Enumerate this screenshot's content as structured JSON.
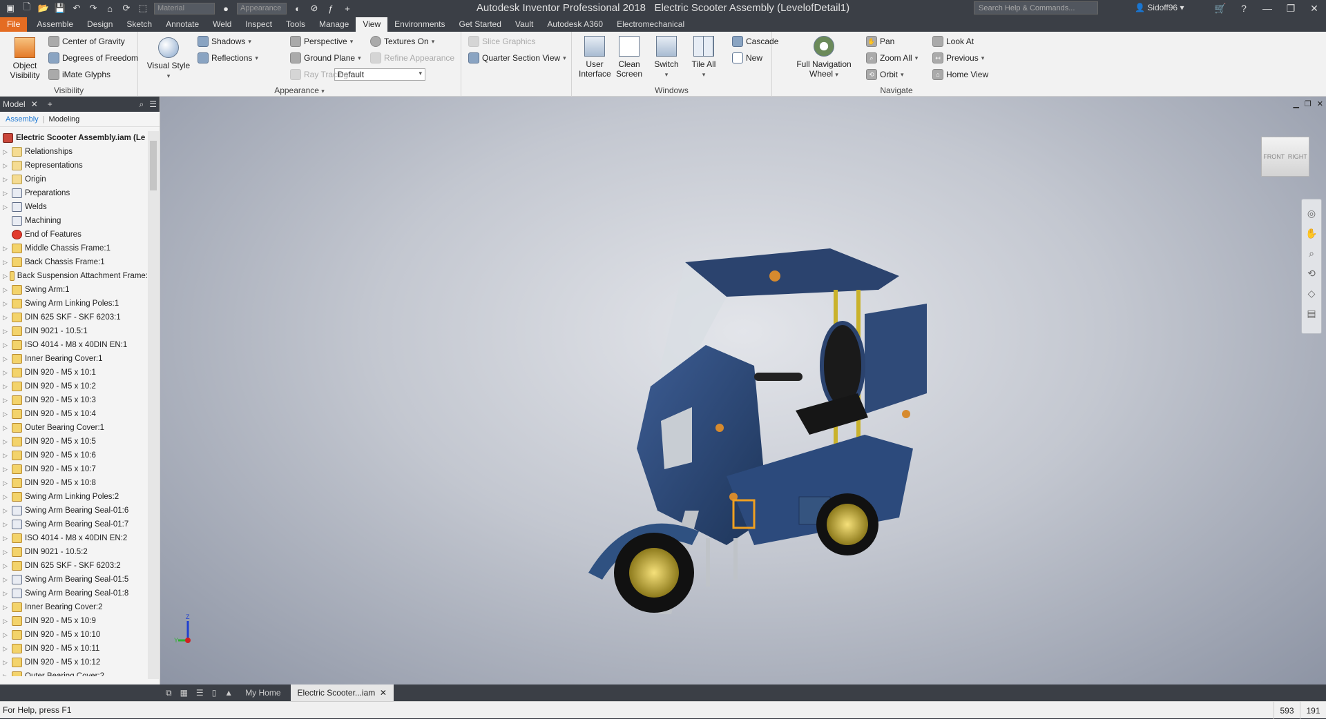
{
  "app": {
    "title": "Autodesk Inventor Professional 2018",
    "document": "Electric Scooter Assembly (LevelofDetail1)",
    "material_placeholder": "Material",
    "appearance_placeholder": "Appearance",
    "search_placeholder": "Search Help & Commands...",
    "user": "Sidoff96"
  },
  "tabs": [
    "File",
    "Assemble",
    "Design",
    "Sketch",
    "Annotate",
    "Weld",
    "Inspect",
    "Tools",
    "Manage",
    "View",
    "Environments",
    "Get Started",
    "Vault",
    "Autodesk A360",
    "Electromechanical"
  ],
  "active_tab": "View",
  "ribbon": {
    "visibility": {
      "label": "Visibility",
      "object_visibility": "Object\nVisibility",
      "center_of_gravity": "Center of Gravity",
      "degrees_of_freedom": "Degrees of Freedom",
      "imate_glyphs": "iMate Glyphs"
    },
    "appearance": {
      "label": "Appearance",
      "visual_style": "Visual Style",
      "shadows": "Shadows",
      "reflections": "Reflections",
      "default": "Default",
      "perspective": "Perspective",
      "ground_plane": "Ground Plane",
      "ray_tracing": "Ray Tracing",
      "textures_on": "Textures On",
      "refine_appearance": "Refine Appearance",
      "slice_graphics": "Slice Graphics",
      "quarter_section_view": "Quarter Section View"
    },
    "windows": {
      "label": "Windows",
      "user_interface": "User\nInterface",
      "clean_screen": "Clean\nScreen",
      "switch": "Switch",
      "tile_all": "Tile All",
      "cascade": "Cascade",
      "new": "New"
    },
    "navigate": {
      "label": "Navigate",
      "full_navigation_wheel": "Full Navigation\nWheel",
      "pan": "Pan",
      "zoom_all": "Zoom All",
      "orbit": "Orbit",
      "look_at": "Look At",
      "previous": "Previous",
      "home_view": "Home View"
    }
  },
  "browser": {
    "title": "Model",
    "tab_assembly": "Assembly",
    "tab_modeling": "Modeling",
    "root": "Electric Scooter Assembly.iam (Le",
    "items": [
      {
        "label": "Relationships",
        "icon": "folder"
      },
      {
        "label": "Representations",
        "icon": "folder"
      },
      {
        "label": "Origin",
        "icon": "folder"
      },
      {
        "label": "Preparations",
        "icon": "blue"
      },
      {
        "label": "Welds",
        "icon": "blue"
      },
      {
        "label": "Machining",
        "icon": "blue"
      },
      {
        "label": "End of Features",
        "icon": "red"
      },
      {
        "label": "Middle Chassis Frame:1",
        "icon": "part"
      },
      {
        "label": "Back Chassis Frame:1",
        "icon": "part"
      },
      {
        "label": "Back Suspension Attachment Frame:",
        "icon": "part"
      },
      {
        "label": "Swing Arm:1",
        "icon": "part"
      },
      {
        "label": "Swing Arm Linking Poles:1",
        "icon": "part"
      },
      {
        "label": "DIN 625 SKF - SKF 6203:1",
        "icon": "part"
      },
      {
        "label": "DIN 9021 - 10.5:1",
        "icon": "part"
      },
      {
        "label": "ISO 4014 - M8 x 40DIN EN:1",
        "icon": "part"
      },
      {
        "label": "Inner Bearing  Cover:1",
        "icon": "part"
      },
      {
        "label": "DIN 920 - M5 x 10:1",
        "icon": "part"
      },
      {
        "label": "DIN 920 - M5 x 10:2",
        "icon": "part"
      },
      {
        "label": "DIN 920 - M5 x 10:3",
        "icon": "part"
      },
      {
        "label": "DIN 920 - M5 x 10:4",
        "icon": "part"
      },
      {
        "label": "Outer Bearing Cover:1",
        "icon": "part"
      },
      {
        "label": "DIN 920 - M5 x 10:5",
        "icon": "part"
      },
      {
        "label": "DIN 920 - M5 x 10:6",
        "icon": "part"
      },
      {
        "label": "DIN 920 - M5 x 10:7",
        "icon": "part"
      },
      {
        "label": "DIN 920 - M5 x 10:8",
        "icon": "part"
      },
      {
        "label": "Swing Arm Linking Poles:2",
        "icon": "part"
      },
      {
        "label": "Swing Arm Bearing Seal-01:6",
        "icon": "blue"
      },
      {
        "label": "Swing Arm Bearing Seal-01:7",
        "icon": "blue"
      },
      {
        "label": "ISO 4014 - M8 x 40DIN EN:2",
        "icon": "part"
      },
      {
        "label": "DIN 9021 - 10.5:2",
        "icon": "part"
      },
      {
        "label": "DIN 625 SKF - SKF 6203:2",
        "icon": "part"
      },
      {
        "label": "Swing Arm Bearing Seal-01:5",
        "icon": "blue"
      },
      {
        "label": "Swing Arm Bearing Seal-01:8",
        "icon": "blue"
      },
      {
        "label": "Inner Bearing  Cover:2",
        "icon": "part"
      },
      {
        "label": "DIN 920 - M5 x 10:9",
        "icon": "part"
      },
      {
        "label": "DIN 920 - M5 x 10:10",
        "icon": "part"
      },
      {
        "label": "DIN 920 - M5 x 10:11",
        "icon": "part"
      },
      {
        "label": "DIN 920 - M5 x 10:12",
        "icon": "part"
      },
      {
        "label": "Outer Bearing Cover:2",
        "icon": "part"
      }
    ]
  },
  "viewcube": {
    "front": "FRONT",
    "right": "RIGHT"
  },
  "triad": {
    "z": "Z",
    "y": "Y"
  },
  "doc_tabs": {
    "home": "My Home",
    "active": "Electric Scooter...iam"
  },
  "status": {
    "help": "For Help, press F1",
    "x": "593",
    "y": "191"
  },
  "colors": {
    "accent_file": "#e46c22",
    "dark_chrome": "#3b3f46",
    "scooter_body": "#2d4a7a",
    "wheel_rim": "#c8b32a"
  }
}
